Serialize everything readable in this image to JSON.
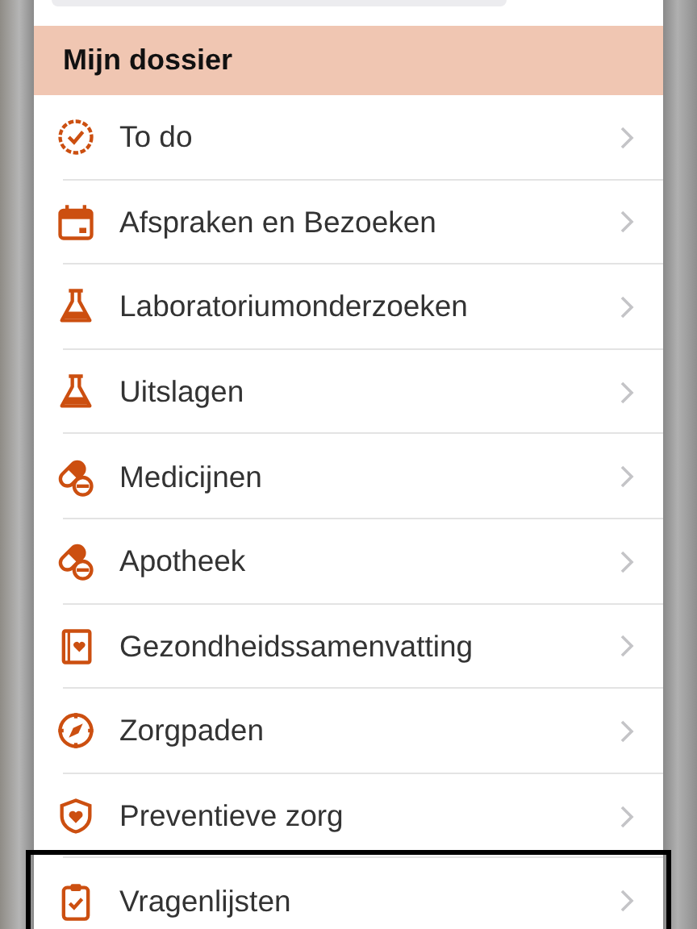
{
  "section": {
    "title": "Mijn dossier"
  },
  "items": [
    {
      "label": "To do",
      "selected": false
    },
    {
      "label": "Afspraken en Bezoeken",
      "selected": false
    },
    {
      "label": "Laboratoriumonderzoeken",
      "selected": false
    },
    {
      "label": "Uitslagen",
      "selected": false
    },
    {
      "label": "Medicijnen",
      "selected": false
    },
    {
      "label": "Apotheek",
      "selected": false
    },
    {
      "label": "Gezondheidssamenvatting",
      "selected": false
    },
    {
      "label": "Zorgpaden",
      "selected": false
    },
    {
      "label": "Preventieve zorg",
      "selected": false
    },
    {
      "label": "Vragenlijsten",
      "selected": true
    }
  ]
}
